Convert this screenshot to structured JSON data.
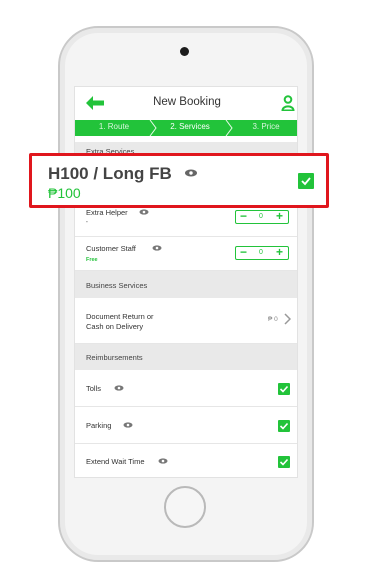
{
  "header": {
    "title": "New Booking"
  },
  "steps": [
    {
      "label": "1. Route"
    },
    {
      "label": "2. Services"
    },
    {
      "label": "3. Price"
    }
  ],
  "sections": {
    "extra_services": "Extra Services",
    "business_services": "Business Services",
    "reimbursements": "Reimbursements"
  },
  "highlight": {
    "title": "H100 / Long FB",
    "price": "₱100",
    "checked": true
  },
  "extra_helper": {
    "label": "Extra Helper",
    "sub": "-",
    "value": "0"
  },
  "customer_staff": {
    "label": "Customer Staff",
    "sub": "Free",
    "value": "0"
  },
  "document_return": {
    "label_line1": "Document Return or",
    "label_line2": "Cash on Delivery",
    "price": "₱ 0"
  },
  "reimbursement_items": [
    {
      "label": "Tolls",
      "checked": true
    },
    {
      "label": "Parking",
      "checked": true
    },
    {
      "label": "Extend Wait Time",
      "checked": true
    }
  ],
  "icons": {
    "back": "arrow-left-icon",
    "user": "user-icon",
    "info": "eye-icon",
    "check": "checkmark-icon",
    "chevron": "chevron-right-icon"
  },
  "colors": {
    "accent": "#22c33a",
    "highlight_border": "#e0161d"
  }
}
